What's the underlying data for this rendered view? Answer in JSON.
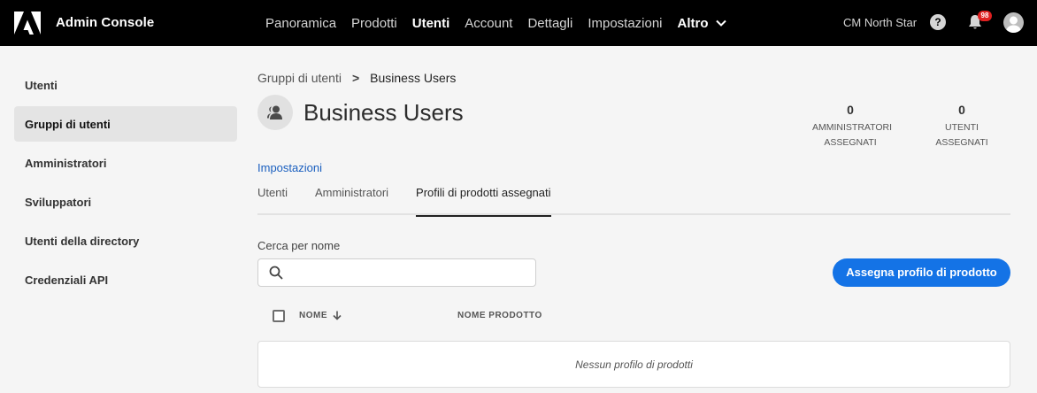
{
  "topbar": {
    "app_title": "Admin Console",
    "nav": [
      "Panoramica",
      "Prodotti",
      "Utenti",
      "Account",
      "Dettagli",
      "Impostazioni"
    ],
    "more_label": "Altro",
    "org_name": "CM North Star",
    "help_glyph": "?",
    "notification_count": "98",
    "icons": {
      "logo": "adobe-logo",
      "help": "help-icon",
      "bell": "bell-icon",
      "avatar": "avatar-icon"
    }
  },
  "sidebar": {
    "items": [
      {
        "label": "Utenti"
      },
      {
        "label": "Gruppi di utenti"
      },
      {
        "label": "Amministratori"
      },
      {
        "label": "Sviluppatori"
      },
      {
        "label": "Utenti della directory"
      },
      {
        "label": "Credenziali API"
      }
    ]
  },
  "breadcrumb": {
    "parent": "Gruppi di utenti",
    "separator": ">",
    "current": "Business Users"
  },
  "page": {
    "title": "Business Users",
    "settings_link": "Impostazioni"
  },
  "stats": {
    "admins": {
      "value": "0",
      "label_line1": "AMMINISTRATORI",
      "label_line2": "ASSEGNATI"
    },
    "users": {
      "value": "0",
      "label": "UTENTI ASSEGNATI"
    }
  },
  "tabs": [
    "Utenti",
    "Amministratori",
    "Profili di prodotti assegnati"
  ],
  "search": {
    "label": "Cerca per nome",
    "value": "",
    "placeholder": ""
  },
  "assign_button": "Assegna profilo di prodotto",
  "table": {
    "col_name": "NOME",
    "col_product": "NOME PRODOTTO",
    "empty_message": "Nessun profilo di prodotti"
  },
  "colors": {
    "accent": "#1473e6",
    "link": "#1a5fbf",
    "topbar": "#000000",
    "badge": "#e02020"
  }
}
